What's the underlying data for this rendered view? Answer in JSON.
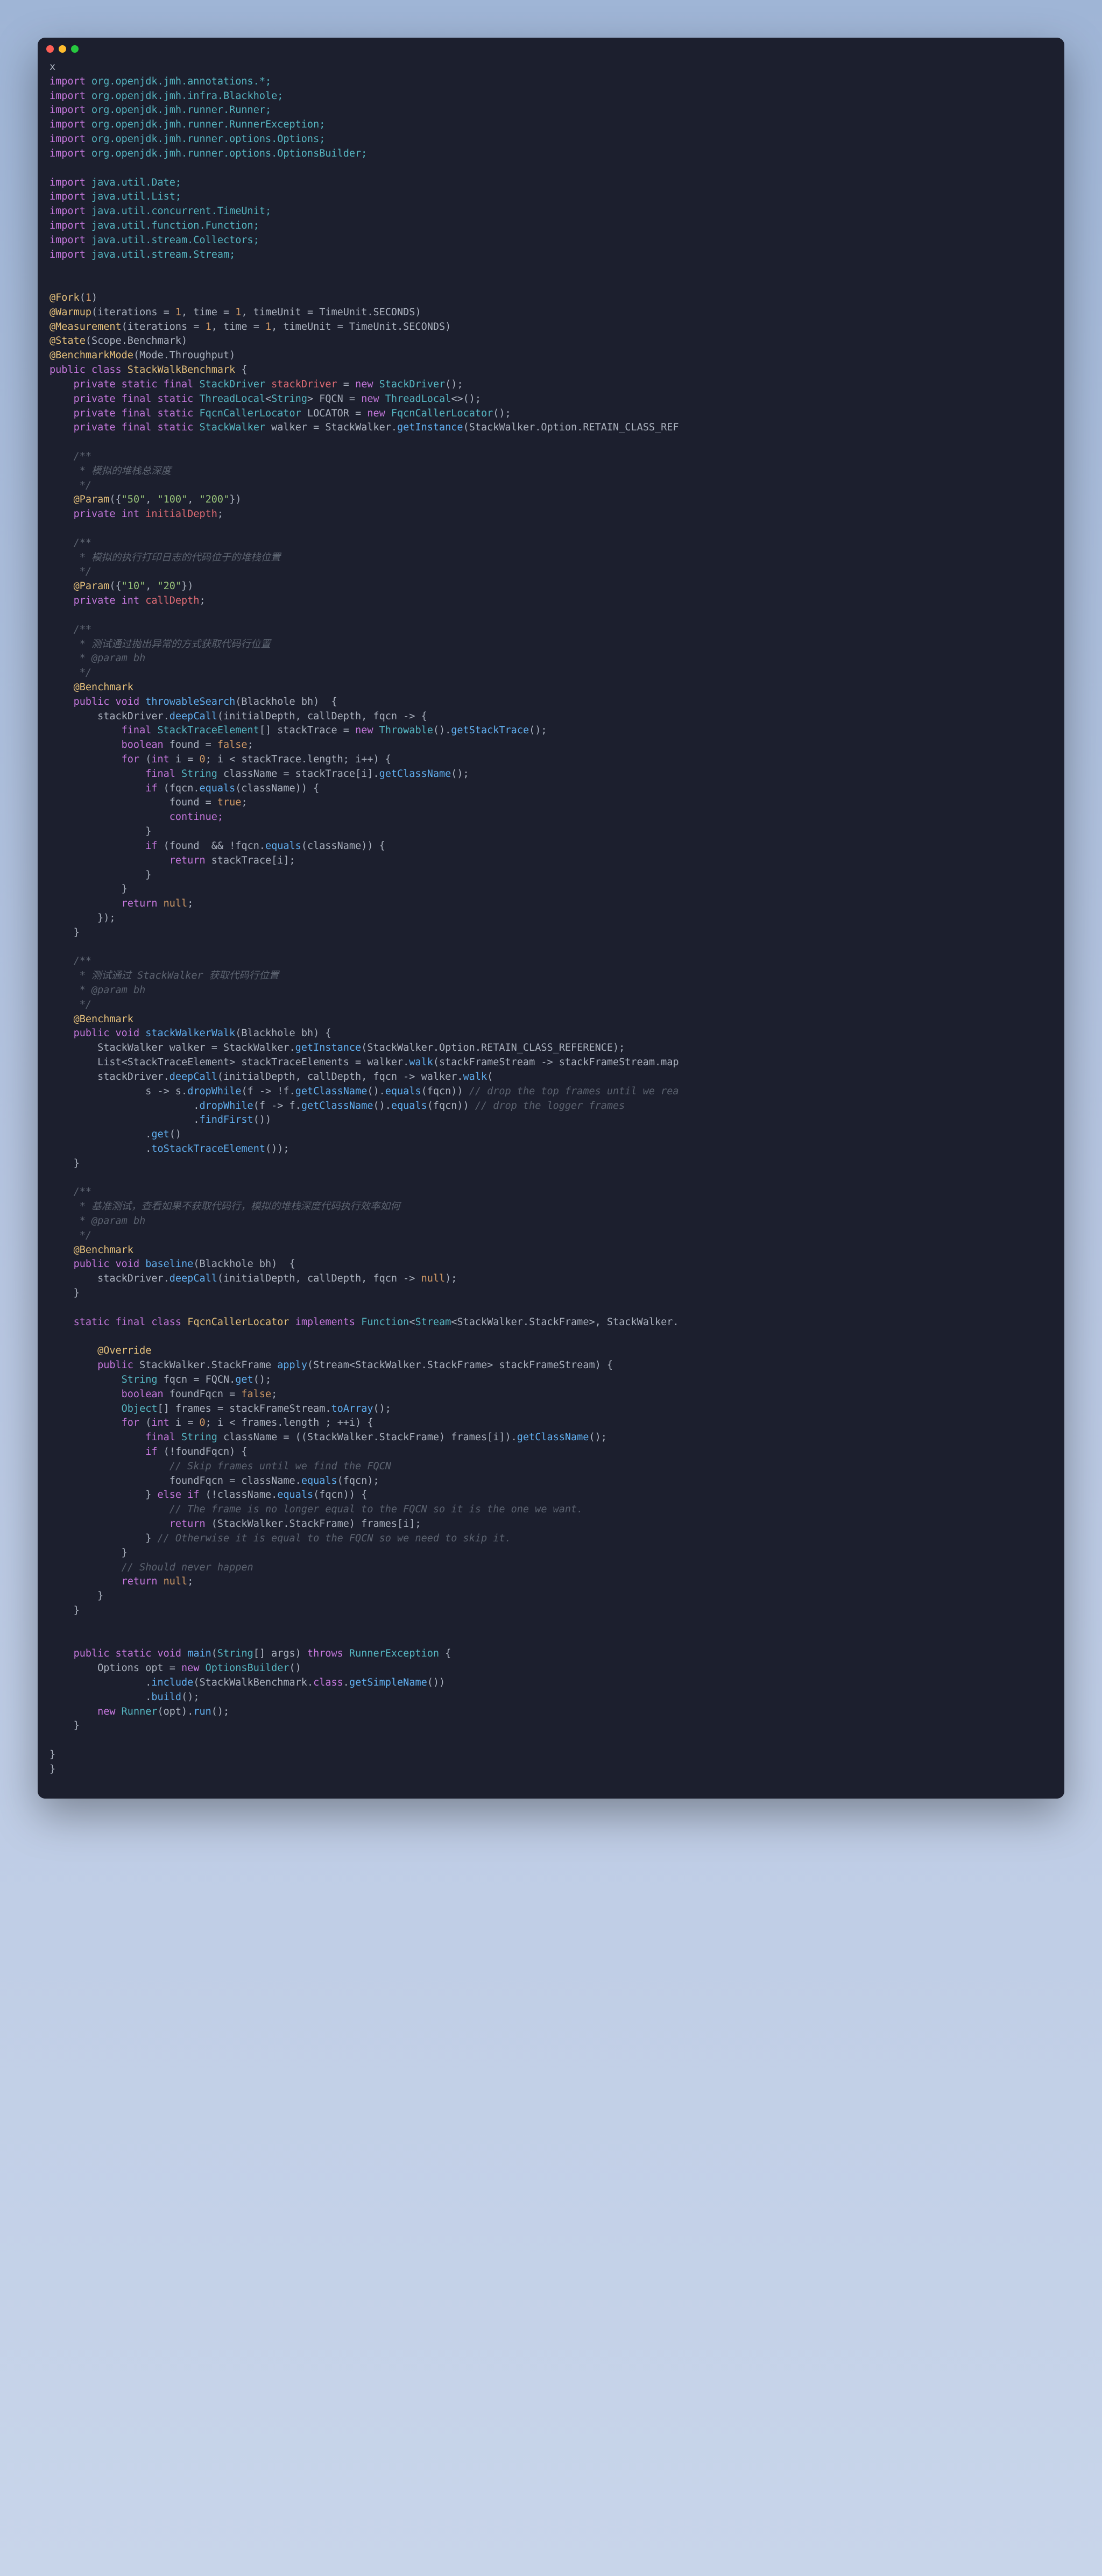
{
  "titlebar": {
    "close": "close",
    "minimize": "minimize",
    "maximize": "maximize"
  },
  "code": {
    "line_x": "x",
    "imp1a": "import",
    "imp1b": " org.openjdk.jmh.annotations.*;",
    "imp2a": "import",
    "imp2b": " org.openjdk.jmh.infra.Blackhole;",
    "imp3a": "import",
    "imp3b": " org.openjdk.jmh.runner.Runner;",
    "imp4a": "import",
    "imp4b": " org.openjdk.jmh.runner.RunnerException;",
    "imp5a": "import",
    "imp5b": " org.openjdk.jmh.runner.options.Options;",
    "imp6a": "import",
    "imp6b": " org.openjdk.jmh.runner.options.OptionsBuilder;",
    "imp7a": "import",
    "imp7b": " java.util.Date;",
    "imp8a": "import",
    "imp8b": " java.util.List;",
    "imp9a": "import",
    "imp9b": " java.util.concurrent.TimeUnit;",
    "imp10a": "import",
    "imp10b": " java.util.function.Function;",
    "imp11a": "import",
    "imp11b": " java.util.stream.Collectors;",
    "imp12a": "import",
    "imp12b": " java.util.stream.Stream;",
    "fork_ann": "@Fork",
    "fork_args_open": "(",
    "fork_val": "1",
    "fork_args_close": ")",
    "warmup": "@Warmup",
    "warmup_args_a": "(iterations = ",
    "warmup_1": "1",
    "warmup_args_b": ", time = ",
    "warmup_2": "1",
    "warmup_args_c": ", timeUnit = TimeUnit.SECONDS)",
    "meas": "@Measurement",
    "meas_args_a": "(iterations = ",
    "meas_1": "1",
    "meas_args_b": ", time = ",
    "meas_2": "1",
    "meas_args_c": ", timeUnit = TimeUnit.SECONDS)",
    "state": "@State",
    "state_args": "(Scope.Benchmark)",
    "bmode": "@BenchmarkMode",
    "bmode_args": "(Mode.Throughput)",
    "cls_decl_a": "public class ",
    "cls_decl_name": "StackWalkBenchmark",
    "cls_decl_b": " {",
    "f1a": "private static final ",
    "f1b": "StackDriver",
    "f1c": " stackDriver",
    "f1d": " = ",
    "f1e": "new ",
    "f1f": "StackDriver",
    "f1g": "();",
    "f2a": "private final static ",
    "f2b": "ThreadLocal",
    "f2c": "<",
    "f2d": "String",
    "f2e": "> FQCN = ",
    "f2f": "new ",
    "f2g": "ThreadLocal",
    "f2h": "<>();",
    "f3a": "private final static ",
    "f3b": "FqcnCallerLocator",
    "f3c": " LOCATOR = ",
    "f3d": "new ",
    "f3e": "FqcnCallerLocator",
    "f3f": "();",
    "f4a": "private final static ",
    "f4b": "StackWalker",
    "f4c": " walker = StackWalker.",
    "f4d": "getInstance",
    "f4e": "(StackWalker.Option.RETAIN_CLASS_REF",
    "c1a": "/**",
    "c1b": " * 模拟的堆栈总深度",
    "c1c": " */",
    "param1_ann": "@Param",
    "param1_args_a": "({",
    "param1_v1": "\"50\"",
    "param1_args_b": ", ",
    "param1_v2": "\"100\"",
    "param1_args_c": ", ",
    "param1_v3": "\"200\"",
    "param1_args_d": "})",
    "fld1a": "private int ",
    "fld1b": "initialDepth",
    "fld1c": ";",
    "c2a": "/**",
    "c2b": " * 模拟的执行打印日志的代码位于的堆栈位置",
    "c2c": " */",
    "param2_ann": "@Param",
    "param2_args_a": "({",
    "param2_v1": "\"10\"",
    "param2_args_b": ", ",
    "param2_v2": "\"20\"",
    "param2_args_c": "})",
    "fld2a": "private int ",
    "fld2b": "callDepth",
    "fld2c": ";",
    "c3a": "/**",
    "c3b": " * 测试通过抛出异常的方式获取代码行位置",
    "c3c": " * @param bh",
    "c3d": " */",
    "bench1": "@Benchmark",
    "m1_sig_a": "public void ",
    "m1_sig_name": "throwableSearch",
    "m1_sig_b": "(Blackhole bh)  {",
    "m1_l1a": "stackDriver.",
    "m1_l1b": "deepCall",
    "m1_l1c": "(initialDepth, callDepth, fqcn -> {",
    "m1_l2a": "final ",
    "m1_l2b": "StackTraceElement",
    "m1_l2c": "[] stackTrace = ",
    "m1_l2d": "new ",
    "m1_l2e": "Throwable",
    "m1_l2f": "().",
    "m1_l2g": "getStackTrace",
    "m1_l2h": "();",
    "m1_l3a": "boolean",
    "m1_l3b": " found = ",
    "m1_l3c": "false",
    "m1_l3d": ";",
    "m1_l4a": "for ",
    "m1_l4b": "(",
    "m1_l4c": "int",
    "m1_l4d": " i = ",
    "m1_l4e": "0",
    "m1_l4f": "; i < stackTrace.length; i++) {",
    "m1_l5a": "final ",
    "m1_l5b": "String",
    "m1_l5c": " className = stackTrace[i].",
    "m1_l5d": "getClassName",
    "m1_l5e": "();",
    "m1_l6a": "if ",
    "m1_l6b": "(fqcn.",
    "m1_l6c": "equals",
    "m1_l6d": "(className)) {",
    "m1_l7a": "found = ",
    "m1_l7b": "true",
    "m1_l7c": ";",
    "m1_l8": "continue;",
    "m1_l9": "}",
    "m1_l10a": "if ",
    "m1_l10b": "(found  && !fqcn.",
    "m1_l10c": "equals",
    "m1_l10d": "(className)) {",
    "m1_l11a": "return ",
    "m1_l11b": "stackTrace[i];",
    "m1_l12": "}",
    "m1_l13": "}",
    "m1_l14a": "return ",
    "m1_l14b": "null",
    "m1_l14c": ";",
    "m1_l15": "});",
    "m1_l16": "}",
    "c4a": "/**",
    "c4b": " * 测试通过 StackWalker 获取代码行位置",
    "c4c": " * @param bh",
    "c4d": " */",
    "bench2": "@Benchmark",
    "m2_sig_a": "public void ",
    "m2_sig_name": "stackWalkerWalk",
    "m2_sig_b": "(Blackhole bh) {",
    "m2_l1a": "StackWalker walker = StackWalker.",
    "m2_l1b": "getInstance",
    "m2_l1c": "(StackWalker.Option.RETAIN_CLASS_REFERENCE);",
    "m2_l2a": "List<StackTraceElement> stackTraceElements = walker.",
    "m2_l2b": "walk",
    "m2_l2c": "(stackFrameStream -> stackFrameStream.map",
    "m2_l3a": "stackDriver.",
    "m2_l3b": "deepCall",
    "m2_l3c": "(initialDepth, callDepth, fqcn -> walker.",
    "m2_l3d": "walk",
    "m2_l3e": "(",
    "m2_l4a": "s -> s.",
    "m2_l4b": "dropWhile",
    "m2_l4c": "(f -> !f.",
    "m2_l4d": "getClassName",
    "m2_l4e": "().",
    "m2_l4f": "equals",
    "m2_l4g": "(fqcn)) ",
    "m2_l4h": "// drop the top frames until we rea",
    "m2_l5a": ".",
    "m2_l5b": "dropWhile",
    "m2_l5c": "(f -> f.",
    "m2_l5d": "getClassName",
    "m2_l5e": "().",
    "m2_l5f": "equals",
    "m2_l5g": "(fqcn)) ",
    "m2_l5h": "// drop the logger frames",
    "m2_l6a": ".",
    "m2_l6b": "findFirst",
    "m2_l6c": "())",
    "m2_l7a": ".",
    "m2_l7b": "get",
    "m2_l7c": "()",
    "m2_l8a": ".",
    "m2_l8b": "toStackTraceElement",
    "m2_l8c": "());",
    "m2_l9": "}",
    "c5a": "/**",
    "c5b": " * 基准测试，查看如果不获取代码行，模拟的堆栈深度代码执行效率如何",
    "c5c": " * @param bh",
    "c5d": " */",
    "bench3": "@Benchmark",
    "m3_sig_a": "public void ",
    "m3_sig_name": "baseline",
    "m3_sig_b": "(Blackhole bh)  {",
    "m3_l1a": "stackDriver.",
    "m3_l1b": "deepCall",
    "m3_l1c": "(initialDepth, callDepth, fqcn -> ",
    "m3_l1d": "null",
    "m3_l1e": ");",
    "m3_l2": "}",
    "innercls_a": "static final class ",
    "innercls_name": "FqcnCallerLocator",
    "innercls_b": " implements ",
    "innercls_c": "Function",
    "innercls_d": "<",
    "innercls_e": "Stream",
    "innercls_f": "<StackWalker.StackFrame>, StackWalker.",
    "override": "@Override",
    "m4_sig_a": "public ",
    "m4_sig_b": "StackWalker.StackFrame ",
    "m4_sig_name": "apply",
    "m4_sig_c": "(Stream<StackWalker.StackFrame> stackFrameStream) {",
    "m4_l1a": "String",
    "m4_l1b": " fqcn = FQCN.",
    "m4_l1c": "get",
    "m4_l1d": "();",
    "m4_l2a": "boolean",
    "m4_l2b": " foundFqcn = ",
    "m4_l2c": "false",
    "m4_l2d": ";",
    "m4_l3a": "Object",
    "m4_l3b": "[] frames = stackFrameStream.",
    "m4_l3c": "toArray",
    "m4_l3d": "();",
    "m4_l4a": "for ",
    "m4_l4b": "(",
    "m4_l4c": "int",
    "m4_l4d": " i = ",
    "m4_l4e": "0",
    "m4_l4f": "; i < frames.length ; ++i) {",
    "m4_l5a": "final ",
    "m4_l5b": "String",
    "m4_l5c": " className = ((StackWalker.StackFrame) frames[i]).",
    "m4_l5d": "getClassName",
    "m4_l5e": "();",
    "m4_l6a": "if ",
    "m4_l6b": "(!foundFqcn) {",
    "m4_l7": "// Skip frames until we find the FQCN",
    "m4_l8a": "foundFqcn = className.",
    "m4_l8b": "equals",
    "m4_l8c": "(fqcn);",
    "m4_l9a": "} ",
    "m4_l9b": "else if ",
    "m4_l9c": "(!className.",
    "m4_l9d": "equals",
    "m4_l9e": "(fqcn)) {",
    "m4_l10": "// The frame is no longer equal to the FQCN so it is the one we want.",
    "m4_l11a": "return ",
    "m4_l11b": "(StackWalker.StackFrame) frames[i];",
    "m4_l12a": "} ",
    "m4_l12b": "// Otherwise it is equal to the FQCN so we need to skip it.",
    "m4_l13": "}",
    "m4_l14": "// Should never happen",
    "m4_l15a": "return ",
    "m4_l15b": "null",
    "m4_l15c": ";",
    "m4_l16": "}",
    "m4_l17": "}",
    "main_sig_a": "public static void ",
    "main_sig_name": "main",
    "main_sig_b": "(",
    "main_sig_c": "String",
    "main_sig_d": "[] args) ",
    "main_sig_e": "throws ",
    "main_sig_f": "RunnerException",
    "main_sig_g": " {",
    "main_l1a": "Options opt = ",
    "main_l1b": "new ",
    "main_l1c": "OptionsBuilder",
    "main_l1d": "()",
    "main_l2a": ".",
    "main_l2b": "include",
    "main_l2c": "(StackWalkBenchmark.",
    "main_l2d": "class",
    "main_l2e": ".",
    "main_l2f": "getSimpleName",
    "main_l2g": "())",
    "main_l3a": ".",
    "main_l3b": "build",
    "main_l3c": "();",
    "main_l4a": "new ",
    "main_l4b": "Runner",
    "main_l4c": "(opt).",
    "main_l4d": "run",
    "main_l4e": "();",
    "main_l5": "}",
    "close1": "}",
    "close2": "}"
  }
}
